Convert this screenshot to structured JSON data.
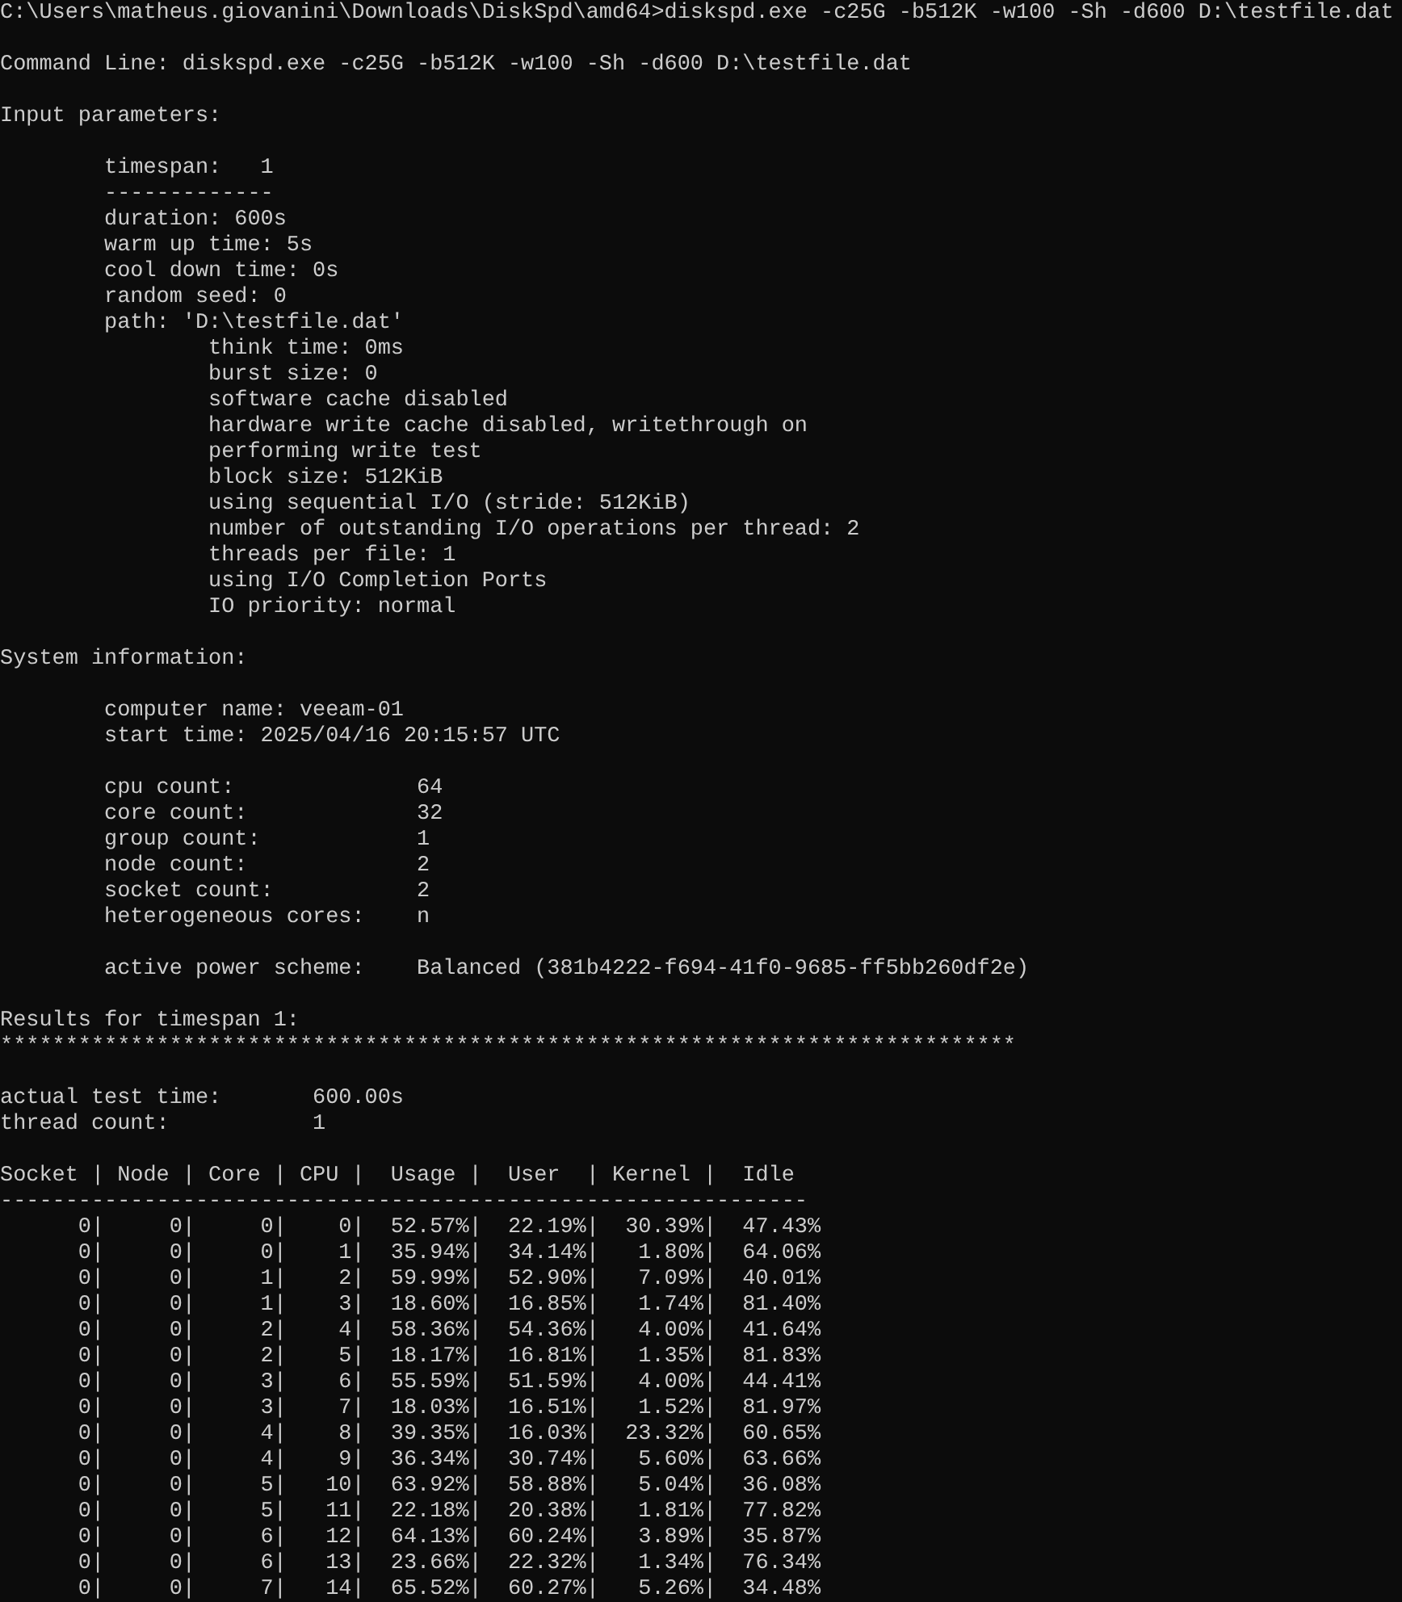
{
  "console": {
    "blocks": [
      [
        "C:\\Users\\matheus.giovanini\\Downloads\\DiskSpd\\amd64>diskspd.exe -c25G -b512K -w100 -Sh -d600 D:\\testfile.dat"
      ],
      [
        "Command Line: diskspd.exe -c25G -b512K -w100 -Sh -d600 D:\\testfile.dat"
      ],
      [
        "Input parameters:"
      ],
      [
        "        timespan:   1",
        "        -------------",
        "        duration: 600s",
        "        warm up time: 5s",
        "        cool down time: 0s",
        "        random seed: 0",
        "        path: 'D:\\testfile.dat'",
        "                think time: 0ms",
        "                burst size: 0",
        "                software cache disabled",
        "                hardware write cache disabled, writethrough on",
        "                performing write test",
        "                block size: 512KiB",
        "                using sequential I/O (stride: 512KiB)",
        "                number of outstanding I/O operations per thread: 2",
        "                threads per file: 1",
        "                using I/O Completion Ports",
        "                IO priority: normal"
      ],
      [
        "System information:"
      ],
      [
        "        computer name: veeam-01",
        "        start time: 2025/04/16 20:15:57 UTC"
      ],
      [
        "        cpu count:              64",
        "        core count:             32",
        "        group count:            1",
        "        node count:             2",
        "        socket count:           2",
        "        heterogeneous cores:    n"
      ],
      [
        "        active power scheme:    Balanced (381b4222-f694-41f0-9685-ff5bb260df2e)"
      ],
      [
        "Results for timespan 1:",
        "******************************************************************************"
      ],
      [
        "actual test time:       600.00s",
        "thread count:           1"
      ],
      [
        "Socket | Node | Core | CPU |  Usage |  User  | Kernel |  Idle",
        "--------------------------------------------------------------",
        "      0|     0|     0|    0|  52.57%|  22.19%|  30.39%|  47.43%",
        "      0|     0|     0|    1|  35.94%|  34.14%|   1.80%|  64.06%",
        "      0|     0|     1|    2|  59.99%|  52.90%|   7.09%|  40.01%",
        "      0|     0|     1|    3|  18.60%|  16.85%|   1.74%|  81.40%",
        "      0|     0|     2|    4|  58.36%|  54.36%|   4.00%|  41.64%",
        "      0|     0|     2|    5|  18.17%|  16.81%|   1.35%|  81.83%",
        "      0|     0|     3|    6|  55.59%|  51.59%|   4.00%|  44.41%",
        "      0|     0|     3|    7|  18.03%|  16.51%|   1.52%|  81.97%",
        "      0|     0|     4|    8|  39.35%|  16.03%|  23.32%|  60.65%",
        "      0|     0|     4|    9|  36.34%|  30.74%|   5.60%|  63.66%",
        "      0|     0|     5|   10|  63.92%|  58.88%|   5.04%|  36.08%",
        "      0|     0|     5|   11|  22.18%|  20.38%|   1.81%|  77.82%",
        "      0|     0|     6|   12|  64.13%|  60.24%|   3.89%|  35.87%",
        "      0|     0|     6|   13|  23.66%|  22.32%|   1.34%|  76.34%",
        "      0|     0|     7|   14|  65.52%|  60.27%|   5.26%|  34.48%"
      ]
    ]
  }
}
